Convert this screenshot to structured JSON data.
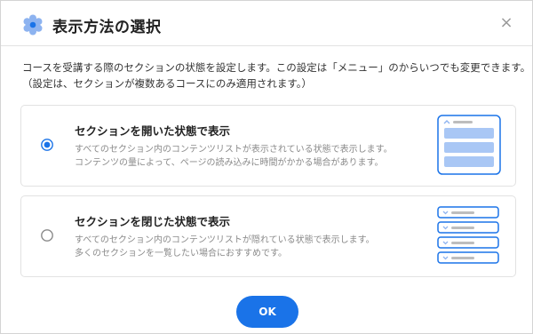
{
  "dialog": {
    "title": "表示方法の選択",
    "description_line1": "コースを受講する際のセクションの状態を設定します。この設定は「メニュー」のからいつでも変更できます。",
    "description_line2": "（設定は、セクションが複数あるコースにのみ適用されます。）",
    "close_icon": "×",
    "accent_color": "#1a73e8"
  },
  "options": [
    {
      "title": "セクションを開いた状態で表示",
      "desc_line1": "すべてのセクション内のコンテンツリストが表示されている状態で表示します。",
      "desc_line2": "コンテンツの量によって、ページの読み込みに時間がかかる場合があります。",
      "selected": true
    },
    {
      "title": "セクションを閉じた状態で表示",
      "desc_line1": "すべてのセクション内のコンテンツリストが隠れている状態で表示します。",
      "desc_line2": "多くのセクションを一覧したい場合におすすめです。",
      "selected": false
    }
  ],
  "ok_label": "OK"
}
